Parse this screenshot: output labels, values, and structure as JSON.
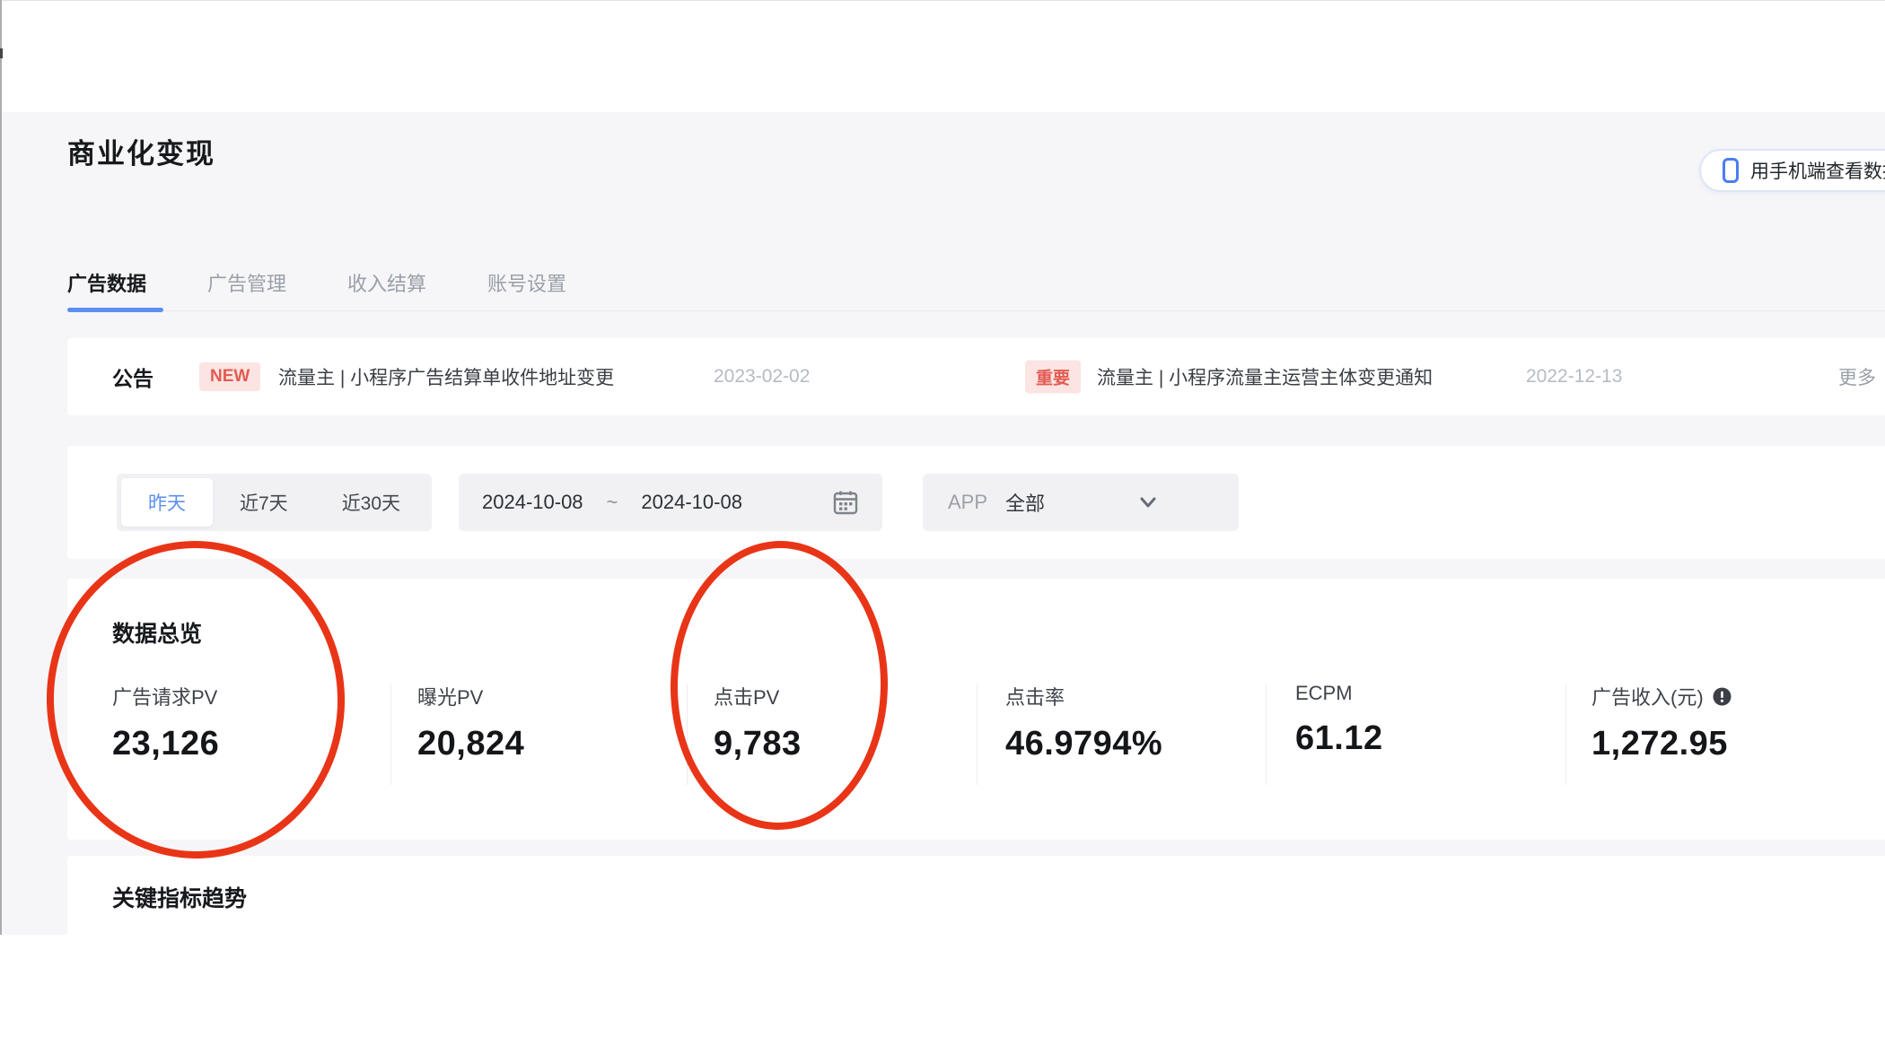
{
  "page": {
    "title": "商业化变现",
    "mobile_button_label": "用手机端查看数据"
  },
  "tabs": [
    {
      "label": "广告数据",
      "active": true
    },
    {
      "label": "广告管理",
      "active": false
    },
    {
      "label": "收入结算",
      "active": false
    },
    {
      "label": "账号设置",
      "active": false
    }
  ],
  "announcement": {
    "heading": "公告",
    "items": [
      {
        "badge": "NEW",
        "text": "流量主 | 小程序广告结算单收件地址变更",
        "date": "2023-02-02"
      },
      {
        "badge": "重要",
        "text": "流量主 | 小程序流量主运营主体变更通知",
        "date": "2022-12-13"
      }
    ],
    "more_label": "更多"
  },
  "filters": {
    "quick_ranges": [
      {
        "label": "昨天",
        "active": true
      },
      {
        "label": "近7天",
        "active": false
      },
      {
        "label": "近30天",
        "active": false
      }
    ],
    "date_range": {
      "start": "2024-10-08",
      "separator": "~",
      "end": "2024-10-08"
    },
    "app_filter": {
      "label": "APP",
      "value": "全部"
    }
  },
  "overview": {
    "heading": "数据总览",
    "metrics": [
      {
        "label": "广告请求PV",
        "value": "23,126",
        "circled": true
      },
      {
        "label": "曝光PV",
        "value": "20,824",
        "circled": false
      },
      {
        "label": "点击PV",
        "value": "9,783",
        "circled": true
      },
      {
        "label": "点击率",
        "value": "46.9794%",
        "circled": false
      },
      {
        "label": "ECPM",
        "value": "61.12",
        "circled": false
      },
      {
        "label": "广告收入(元)",
        "value": "1,272.95",
        "circled": false,
        "has_info_icon": true
      }
    ]
  },
  "trends": {
    "heading": "关键指标趋势"
  },
  "icons": [
    "phone-icon",
    "calendar-icon",
    "chevron-down-icon",
    "info-icon"
  ],
  "colors": {
    "accent_blue": "#5b8ff2",
    "badge_red_text": "#e25b52",
    "badge_red_bg": "#fbe4e2",
    "annotation_red": "#e93517",
    "page_bg": "#f6f6f8",
    "card_bg": "#ffffff"
  }
}
